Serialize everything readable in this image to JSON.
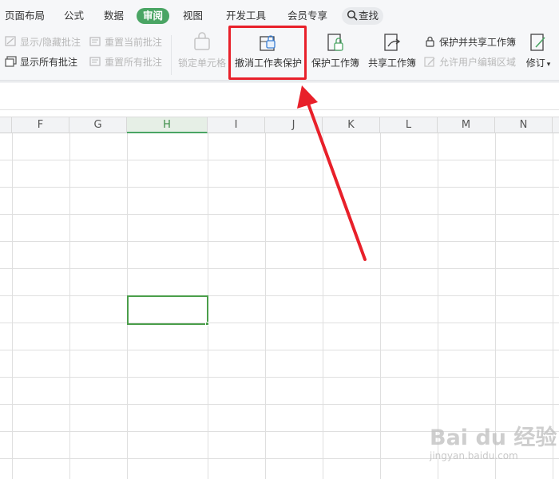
{
  "menu": {
    "tabs": [
      {
        "label": "页面布局"
      },
      {
        "label": "公式"
      },
      {
        "label": "数据"
      },
      {
        "label": "审阅",
        "active": true
      },
      {
        "label": "视图"
      },
      {
        "label": "开发工具"
      },
      {
        "label": "会员专享"
      }
    ],
    "search_label": "查找"
  },
  "ribbon": {
    "show_hide_comments": "显示/隐藏批注",
    "show_all_comments": "显示所有批注",
    "reset_current_comment": "重置当前批注",
    "reset_all_comments": "重置所有批注",
    "lock_cell": "锁定单元格",
    "unprotect_sheet": "撤消工作表保护",
    "protect_workbook": "保护工作簿",
    "share_workbook": "共享工作簿",
    "protect_and_share": "保护并共享工作簿",
    "allow_edit_ranges": "允许用户编辑区域",
    "track_changes": "修订"
  },
  "sheet": {
    "columns": [
      "F",
      "G",
      "H",
      "I",
      "J",
      "K",
      "L",
      "M",
      "N"
    ],
    "active_column": "H"
  },
  "watermark": {
    "brand": "Bai du 经验",
    "url": "jingyan.baidu.com"
  },
  "colors": {
    "accent": "#4aa564",
    "highlight": "#e8202a"
  }
}
